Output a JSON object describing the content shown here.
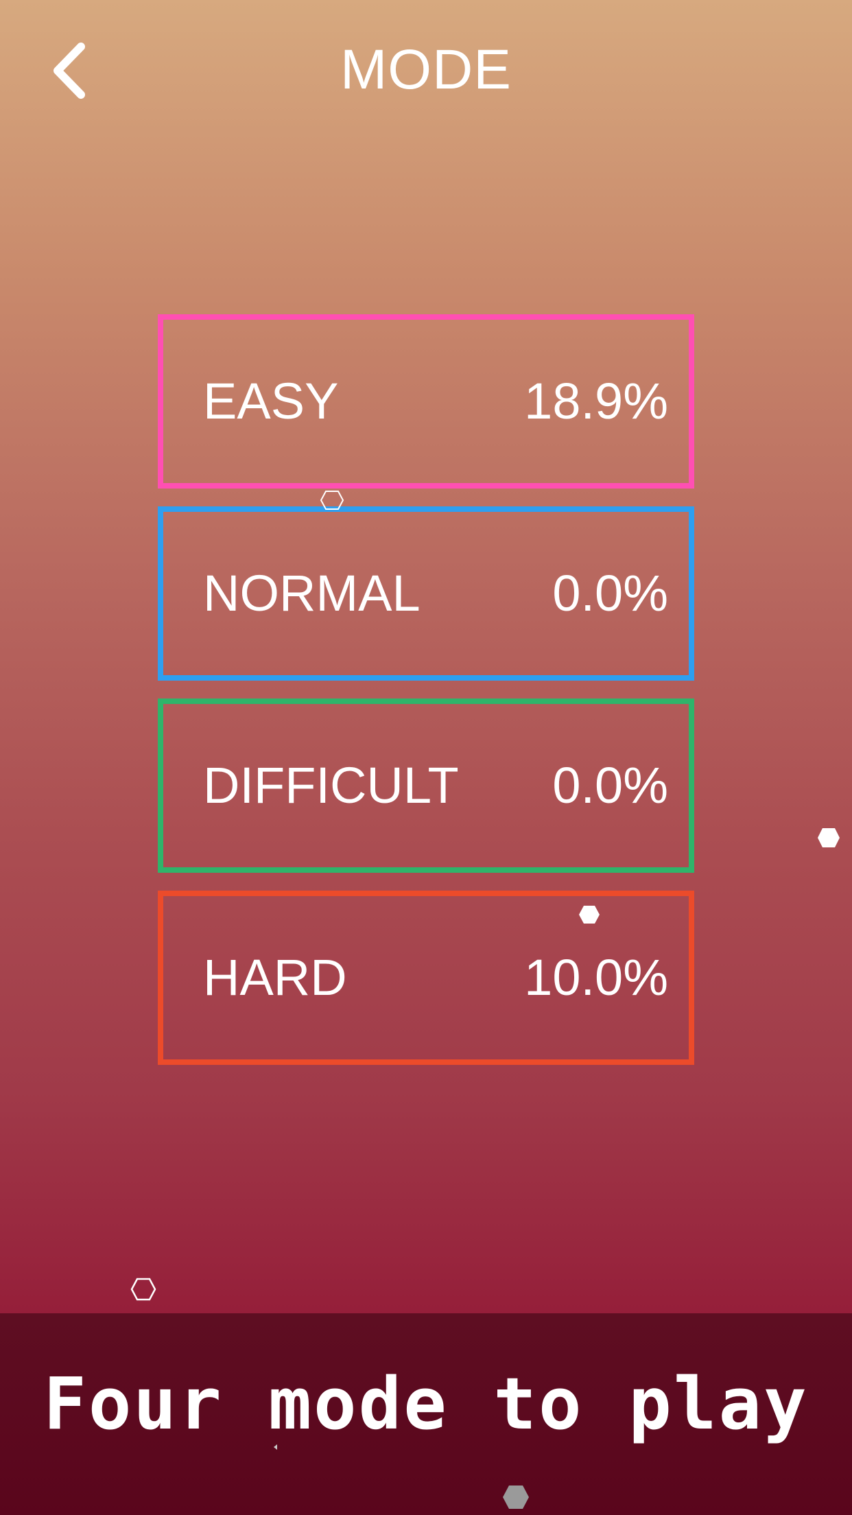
{
  "header": {
    "title": "MODE",
    "back_icon": "chevron-left-icon"
  },
  "modes": [
    {
      "label": "EASY",
      "value": "18.9%",
      "color": "#ff4fb3"
    },
    {
      "label": "NORMAL",
      "value": "0.0%",
      "color": "#2e9ff0"
    },
    {
      "label": "DIFFICULT",
      "value": "0.0%",
      "color": "#2fb46a"
    },
    {
      "label": "HARD",
      "value": "10.0%",
      "color": "#ec4b2a"
    }
  ],
  "banner": {
    "text": "Four mode to play"
  },
  "colors": {
    "background_top": "#d7a97f",
    "background_bottom": "#8f1535",
    "banner": "#5a051c",
    "text": "#ffffff"
  }
}
